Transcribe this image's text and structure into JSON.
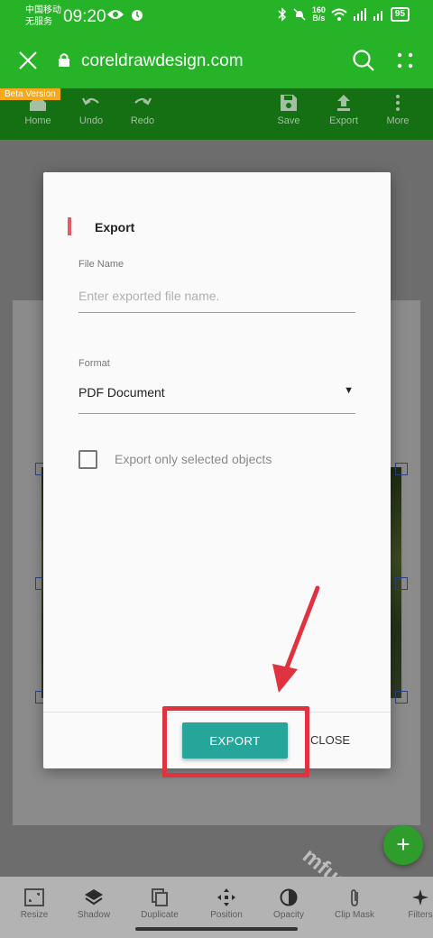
{
  "status": {
    "carrier_line1": "中国移动",
    "carrier_line2": "无服务",
    "time": "09:20",
    "speed_value": "160",
    "speed_unit": "B/s",
    "battery": "95"
  },
  "browser": {
    "url": "coreldrawdesign.com"
  },
  "toolbar": {
    "beta_badge": "Beta Version",
    "home": "Home",
    "undo": "Undo",
    "redo": "Redo",
    "save": "Save",
    "export": "Export",
    "more": "More"
  },
  "dialog": {
    "title": "Export",
    "file_name_label": "File Name",
    "file_name_placeholder": "Enter exported file name.",
    "file_name_value": "",
    "format_label": "Format",
    "format_value": "PDF Document",
    "checkbox_label": "Export only selected objects",
    "checkbox_checked": false,
    "export_button": "EXPORT",
    "close_button": "CLOSE"
  },
  "fab": {
    "label": "+"
  },
  "watermark": "mfunz.com 魔趣网",
  "bottom_tools": [
    "Resize",
    "Shadow",
    "Duplicate",
    "Position",
    "Opacity",
    "Clip Mask",
    "Filters"
  ],
  "colors": {
    "browser_green": "#27b327",
    "toolbar_green": "#157014",
    "accent": "#e35b63",
    "export_teal": "#26a69a",
    "highlight_red": "#e0323f"
  }
}
